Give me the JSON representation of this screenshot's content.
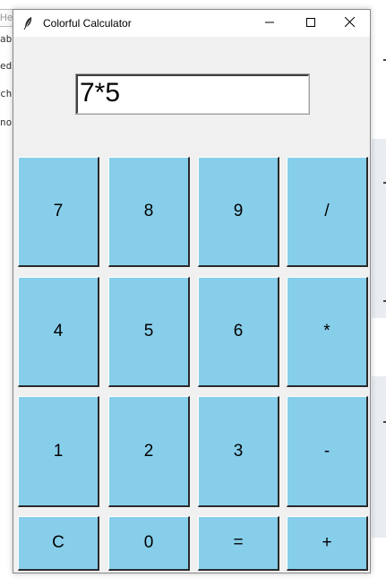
{
  "background": {
    "tab_text": "He",
    "left_text_fragments": [
      "abc",
      "edi",
      "cho",
      "nor"
    ]
  },
  "window": {
    "title": "Colorful Calculator",
    "icon": "feather-icon",
    "controls": {
      "minimize": "minimize-icon",
      "maximize": "maximize-icon",
      "close": "close-icon"
    }
  },
  "display": {
    "value": "7*5"
  },
  "keypad": {
    "rows": [
      [
        "7",
        "8",
        "9",
        "/"
      ],
      [
        "4",
        "5",
        "6",
        "*"
      ],
      [
        "1",
        "2",
        "3",
        "-"
      ],
      [
        "C",
        "0",
        "=",
        "+"
      ]
    ],
    "button_color": "#87ceeb"
  }
}
